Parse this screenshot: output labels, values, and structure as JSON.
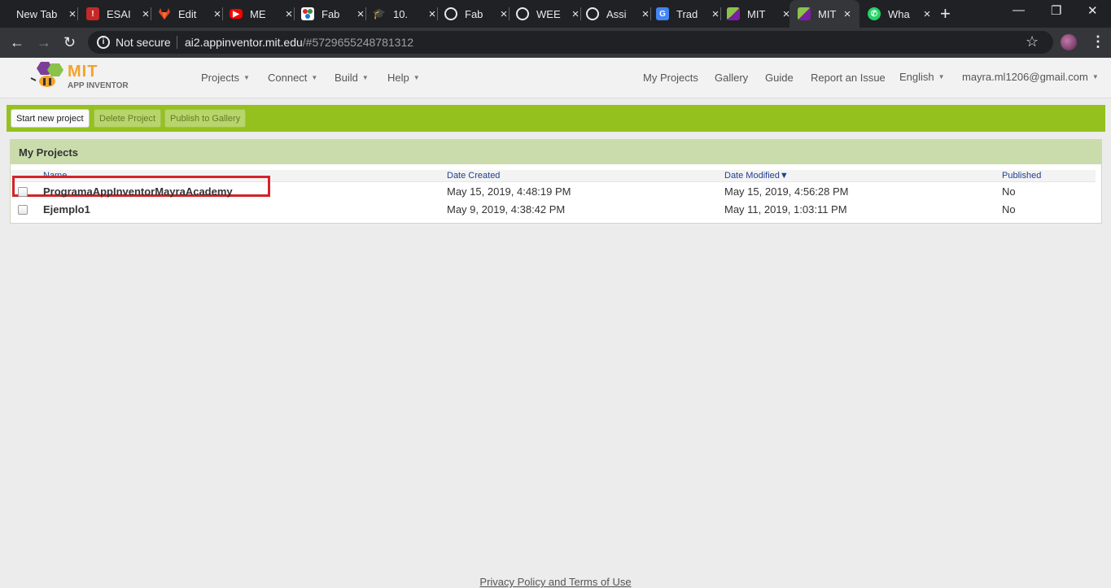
{
  "tabs": [
    {
      "title": "New Tab",
      "icon": "none",
      "color": ""
    },
    {
      "title": "ESAI",
      "icon": "shield-icon",
      "color": "#c62828"
    },
    {
      "title": "Edit",
      "icon": "gitlab-icon",
      "color": "#e24329"
    },
    {
      "title": "ME",
      "icon": "youtube-icon",
      "color": "#ff0000"
    },
    {
      "title": "Fab",
      "icon": "fablab-icon",
      "color": "#2e7d32"
    },
    {
      "title": "10.",
      "icon": "graduation-cap-icon",
      "color": "#111111"
    },
    {
      "title": "Fab",
      "icon": "globe-icon",
      "color": "#e8eaed"
    },
    {
      "title": "WEE",
      "icon": "globe-icon",
      "color": "#e8eaed"
    },
    {
      "title": "Assi",
      "icon": "globe-icon",
      "color": "#e8eaed"
    },
    {
      "title": "Trad",
      "icon": "translate-icon",
      "color": "#4285f4"
    },
    {
      "title": "MIT",
      "icon": "app-inventor-icon",
      "color": "#8bc34a"
    },
    {
      "title": "MIT",
      "icon": "app-inventor-icon",
      "color": "#8bc34a",
      "active": true
    },
    {
      "title": "Wha",
      "icon": "whatsapp-icon",
      "color": "#25d366"
    }
  ],
  "browser": {
    "security_label": "Not secure",
    "url_host": "ai2.appinventor.mit.edu",
    "url_path": "/#5729655248781312"
  },
  "header": {
    "logo_mit": "MIT",
    "logo_sub": "APP INVENTOR",
    "menus": [
      "Projects",
      "Connect",
      "Build",
      "Help"
    ],
    "links": [
      "My Projects",
      "Gallery",
      "Guide",
      "Report an Issue"
    ],
    "language": "English",
    "account": "mayra.ml1206@gmail.com"
  },
  "actions": {
    "start_new": "Start new project",
    "delete": "Delete Project",
    "publish": "Publish to Gallery"
  },
  "projects": {
    "title": "My Projects",
    "columns": {
      "name": "Name",
      "created": "Date Created",
      "modified": "Date Modified",
      "sort_indicator": "▼",
      "published": "Published"
    },
    "rows": [
      {
        "name": "ProgramaAppInventorMayraAcademy",
        "created": "May 15, 2019, 4:48:19 PM",
        "modified": "May 15, 2019, 4:56:28 PM",
        "published": "No",
        "highlighted": true
      },
      {
        "name": "Ejemplo1",
        "created": "May 9, 2019, 4:38:42 PM",
        "modified": "May 11, 2019, 1:03:11 PM",
        "published": "No",
        "highlighted": false
      }
    ]
  },
  "footer": {
    "link": "Privacy Policy and Terms of Use"
  },
  "colors": {
    "green_bar": "#95c11f",
    "panel_header": "#cadcac",
    "highlight_box": "#d3232a",
    "column_header": "#1f3f91"
  }
}
